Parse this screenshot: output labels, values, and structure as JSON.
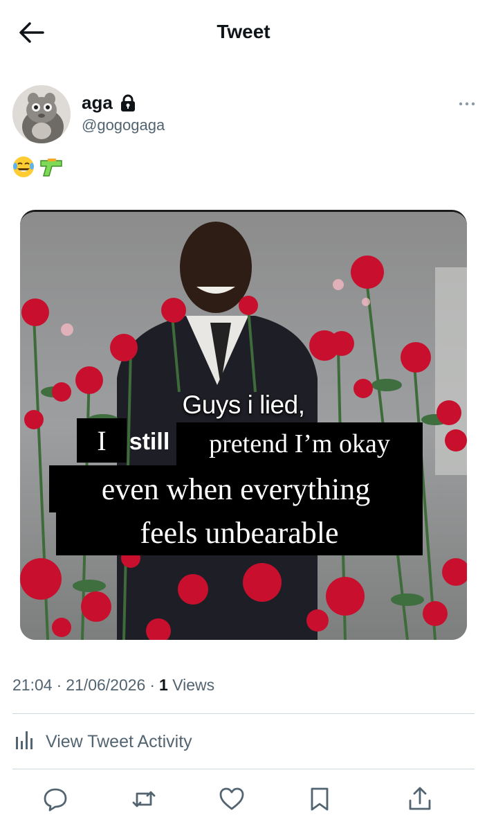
{
  "header": {
    "title": "Tweet"
  },
  "author": {
    "name": "aga",
    "handle": "@gogogaga"
  },
  "tweet": {
    "emojis": [
      "😂",
      "🔫"
    ],
    "media_caption": {
      "line1": "Guys i lied,",
      "line2_a": "I",
      "line2_b": "still",
      "line2_c": "pretend I’m okay",
      "line3": "even when everything",
      "line4": "feels unbearable"
    }
  },
  "meta": {
    "time": "21:04",
    "date": "21/06/2026",
    "views_count": "1",
    "views_label": "Views",
    "separator": "·"
  },
  "activity": {
    "label": "View Tweet Activity"
  },
  "actions": [
    "reply-icon",
    "retweet-icon",
    "like-icon",
    "bookmark-icon",
    "share-icon"
  ],
  "colors": {
    "rose": "#c8102e",
    "muted": "#536471",
    "divider": "#cfd9de"
  }
}
